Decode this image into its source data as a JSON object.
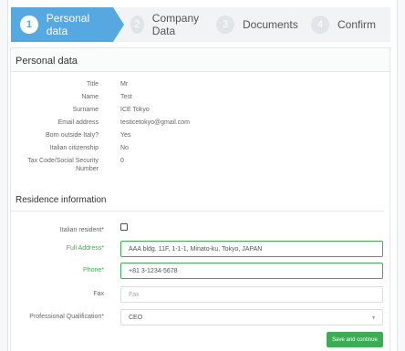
{
  "steps": [
    {
      "num": "1",
      "label": "Personal data"
    },
    {
      "num": "2",
      "label": "Company Data"
    },
    {
      "num": "3",
      "label": "Documents"
    },
    {
      "num": "4",
      "label": "Confirm"
    }
  ],
  "panel_title": "Personal data",
  "personal": [
    {
      "key": "Title",
      "value": "Mr"
    },
    {
      "key": "Name",
      "value": "Test"
    },
    {
      "key": "Surname",
      "value": "ICE Tokyo"
    },
    {
      "key": "Email address",
      "value": "testicetokyo@gmail.com"
    },
    {
      "key": "Born outside Italy?",
      "value": "Yes"
    },
    {
      "key": "Italian citizenship",
      "value": "No"
    },
    {
      "key": "Tax Code/Social Security",
      "key2": "Number",
      "value": "0"
    }
  ],
  "residence_title": "Residence information",
  "fields": {
    "italian_resident_label": "Italian resident*",
    "full_address_label": "Full Address*",
    "full_address_value": "AAA bldg. 11F, 1-1-1, Minato-ku, Tokyo, JAPAN",
    "phone_label": "Phone*",
    "phone_value": "+81 3-1234-5678",
    "fax_label": "Fax",
    "fax_placeholder": "Fax",
    "qualification_label": "Professional Qualification*",
    "qualification_value": "CEO"
  },
  "save_label": "Save and continue"
}
